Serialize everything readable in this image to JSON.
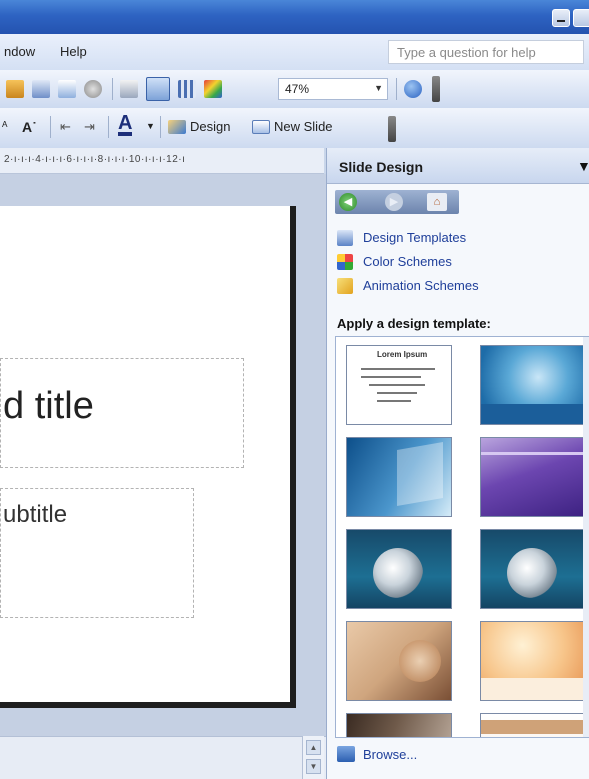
{
  "menu": {
    "items": [
      "ndow",
      "Help"
    ]
  },
  "help_box": {
    "placeholder": "Type a question for help"
  },
  "toolbar": {
    "zoom_value": "47%",
    "design_label": "Design",
    "new_slide_label": "New Slide"
  },
  "ruler": {
    "text": "2·ı·ı·ı·4·ı·ı·ı·6·ı·ı·ı·8·ı·ı·ı·10·ı·ı·ı·12·ı"
  },
  "slide": {
    "title_text": "d title",
    "subtitle_text": "ubtitle"
  },
  "task_pane": {
    "title": "Slide Design",
    "links": [
      "Design Templates",
      "Color Schemes",
      "Animation Schemes"
    ],
    "apply_label": "Apply a design template:",
    "browse_label": "Browse..."
  },
  "thumb_preview": {
    "title": "Lorem Ipsum"
  },
  "colors": {
    "titlebar": "#2e63c2",
    "link": "#1f3f9a",
    "pane_bg": "#f5f8fc",
    "edit_bg": "#c5d0e3"
  },
  "icons": [
    "minimize-icon",
    "maximize-icon",
    "zoom-dropdown-icon",
    "help-icon",
    "font-color-icon",
    "design-icon",
    "new-slide-icon",
    "back-icon",
    "forward-icon",
    "home-icon",
    "pane-menu-icon",
    "browse-icon"
  ]
}
